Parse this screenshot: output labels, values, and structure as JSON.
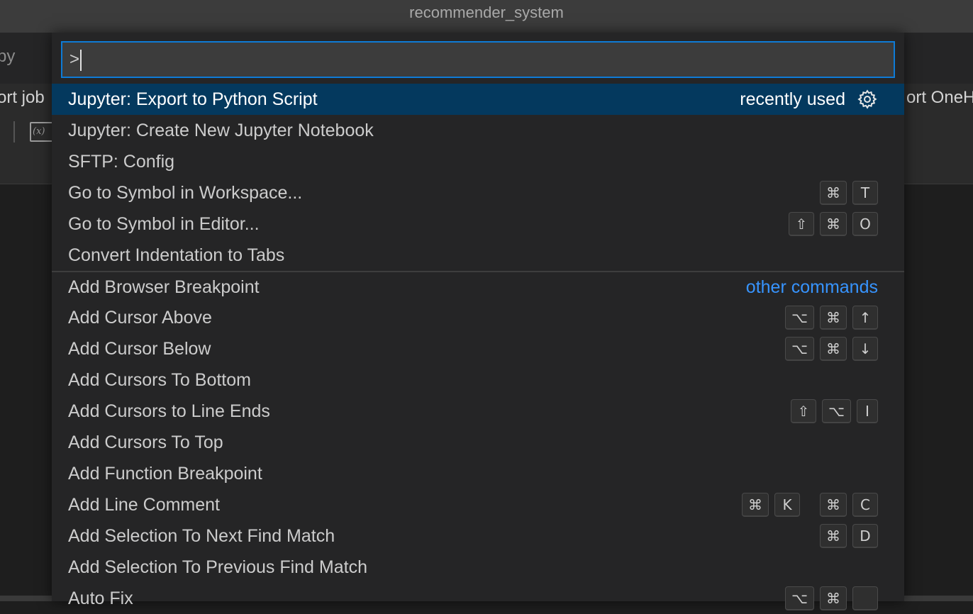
{
  "window": {
    "title": "recommender_system"
  },
  "background": {
    "tab_fragment": "py",
    "breadcrumb_left": "ort job",
    "breadcrumb_right": "ort OneH",
    "variables_icon_label": "(x)"
  },
  "palette": {
    "input_value": ">",
    "items": [
      {
        "label": "Jupyter: Export to Python Script",
        "hint": "recently used",
        "selected": true
      },
      {
        "label": "Jupyter: Create New Jupyter Notebook"
      },
      {
        "label": "SFTP: Config"
      },
      {
        "label": "Go to Symbol in Workspace...",
        "keys": [
          "⌘",
          "T"
        ]
      },
      {
        "label": "Go to Symbol in Editor...",
        "keys": [
          "⇧",
          "⌘",
          "O"
        ]
      },
      {
        "label": "Convert Indentation to Tabs"
      },
      {
        "label": "Add Browser Breakpoint",
        "hint": "other commands"
      },
      {
        "label": "Add Cursor Above",
        "keys": [
          "⌥",
          "⌘",
          "↑"
        ]
      },
      {
        "label": "Add Cursor Below",
        "keys": [
          "⌥",
          "⌘",
          "↓"
        ]
      },
      {
        "label": "Add Cursors To Bottom"
      },
      {
        "label": "Add Cursors to Line Ends",
        "keys": [
          "⇧",
          "⌥",
          "I"
        ]
      },
      {
        "label": "Add Cursors To Top"
      },
      {
        "label": "Add Function Breakpoint"
      },
      {
        "label": "Add Line Comment",
        "keys": [
          "⌘",
          "K"
        ],
        "keys2": [
          "⌘",
          "C"
        ]
      },
      {
        "label": "Add Selection To Next Find Match",
        "keys": [
          "⌘",
          "D"
        ]
      },
      {
        "label": "Add Selection To Previous Find Match"
      },
      {
        "label": "Auto Fix",
        "keys": [
          "⌥",
          "⌘",
          ""
        ]
      }
    ]
  },
  "colors": {
    "accent": "#0e7bd6",
    "selection": "#04395e",
    "link": "#3794ff"
  }
}
